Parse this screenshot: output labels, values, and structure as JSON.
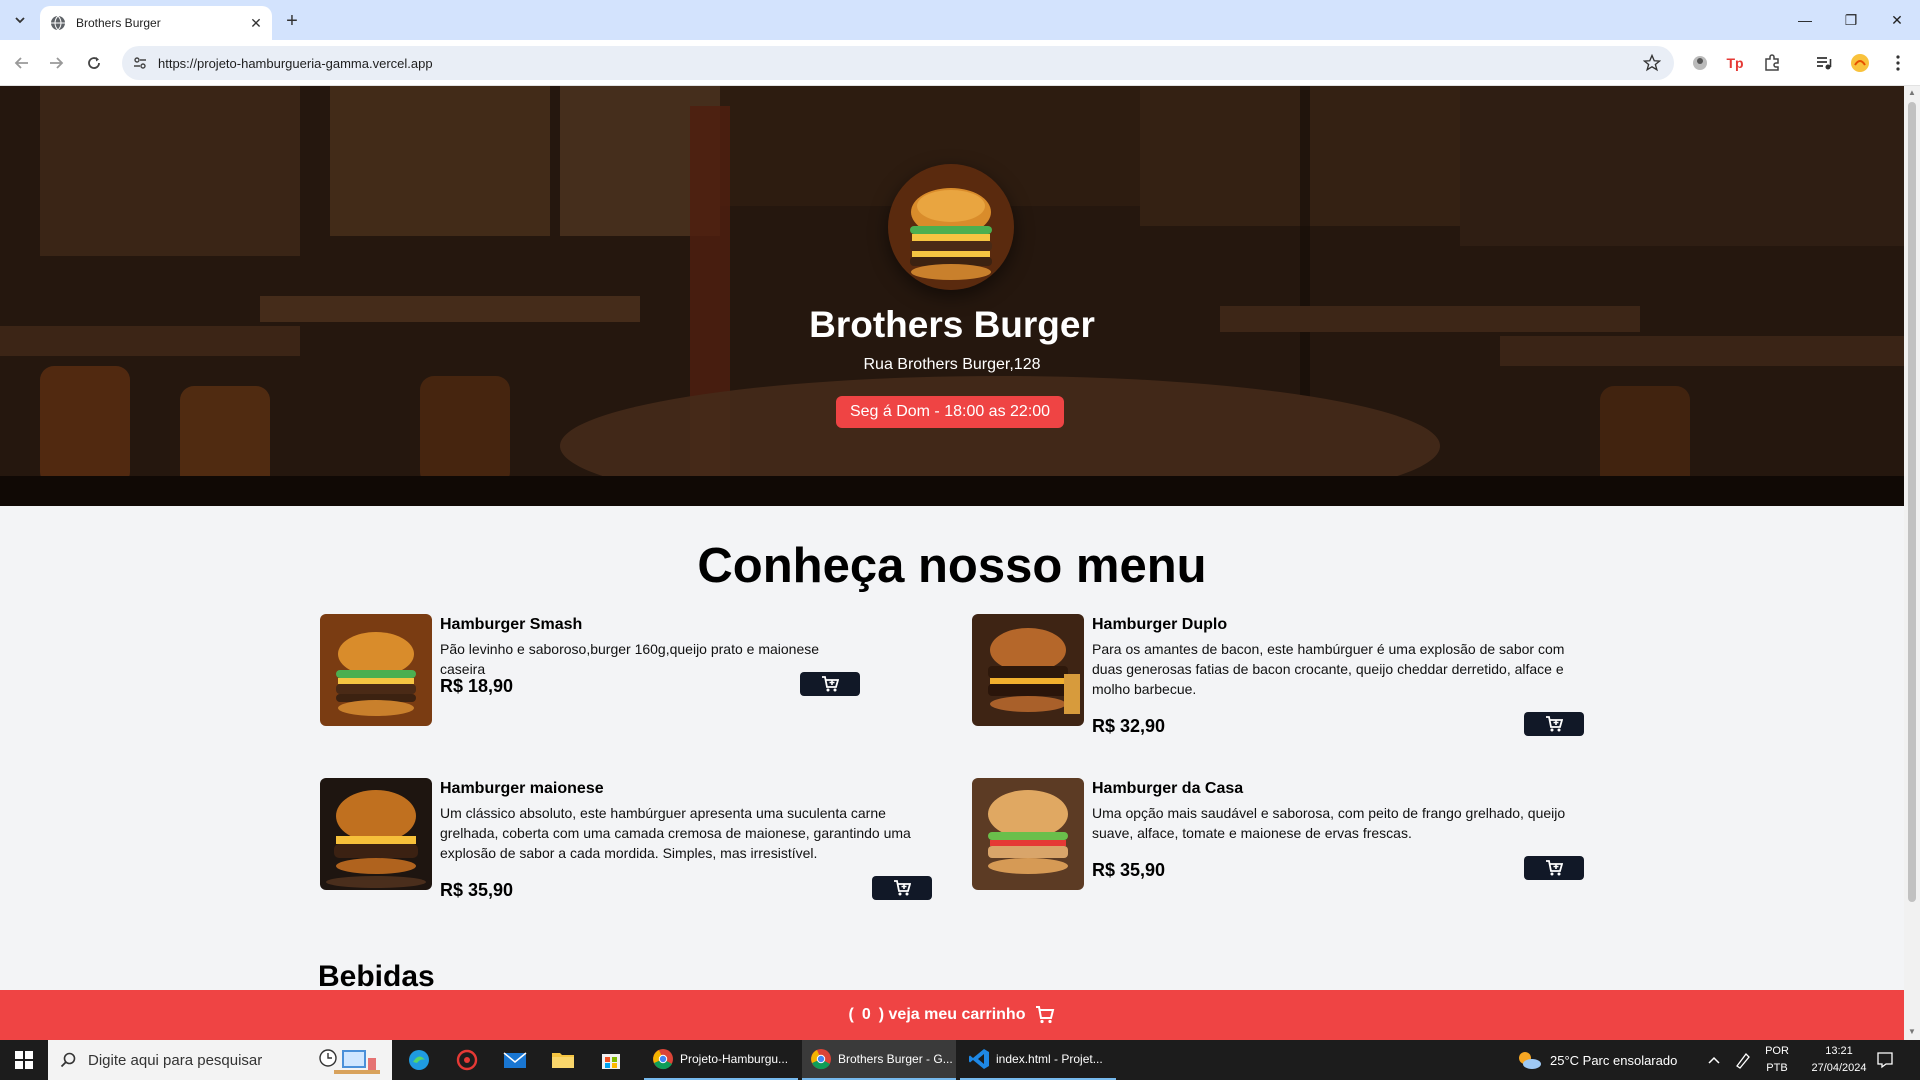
{
  "browser": {
    "tab_title": "Brothers Burger",
    "url": "https://projeto-hamburgueria-gamma.vercel.app"
  },
  "hero": {
    "title": "Brothers Burger",
    "address": "Rua Brothers Burger,128",
    "hours": "Seg á Dom - 18:00 as 22:00"
  },
  "menu": {
    "title": "Conheça nosso menu",
    "items": [
      {
        "name": "Hamburger Smash",
        "description": "Pão levinho e saboroso,burger 160g,queijo prato e maionese caseira",
        "price": "R$ 18,90"
      },
      {
        "name": "Hamburger Duplo",
        "description": "Para os amantes de bacon, este hambúrguer é uma explosão de sabor com duas generosas fatias de bacon crocante, queijo cheddar derretido, alface e molho barbecue.",
        "price": "R$ 32,90"
      },
      {
        "name": "Hamburger maionese",
        "description": "Um clássico absoluto, este hambúrguer apresenta uma suculenta carne grelhada, coberta com uma camada cremosa de maionese, garantindo uma explosão de sabor a cada mordida. Simples, mas irresistível.",
        "price": "R$ 35,90"
      },
      {
        "name": "Hamburger da Casa",
        "description": "Uma opção mais saudável e saborosa, com peito de frango grelhado, queijo suave, alface, tomate e maionese de ervas frescas.",
        "price": "R$ 35,90"
      }
    ]
  },
  "drinks": {
    "title": "Bebidas"
  },
  "footer": {
    "open_paren": "(",
    "count": "0",
    "label": ") veja meu carrinho"
  },
  "taskbar": {
    "search_placeholder": "Digite aqui para pesquisar",
    "apps": [
      {
        "label": "Projeto-Hamburgu..."
      },
      {
        "label": "Brothers Burger - G..."
      },
      {
        "label": "index.html - Projet..."
      }
    ],
    "weather": "25°C  Parc ensolarado",
    "lang_top": "POR",
    "lang_bottom": "PTB",
    "time": "13:21",
    "date": "27/04/2024"
  },
  "colors": {
    "accent": "#ef4444",
    "button_dark": "#111827",
    "tabbar": "#d3e3fd"
  }
}
